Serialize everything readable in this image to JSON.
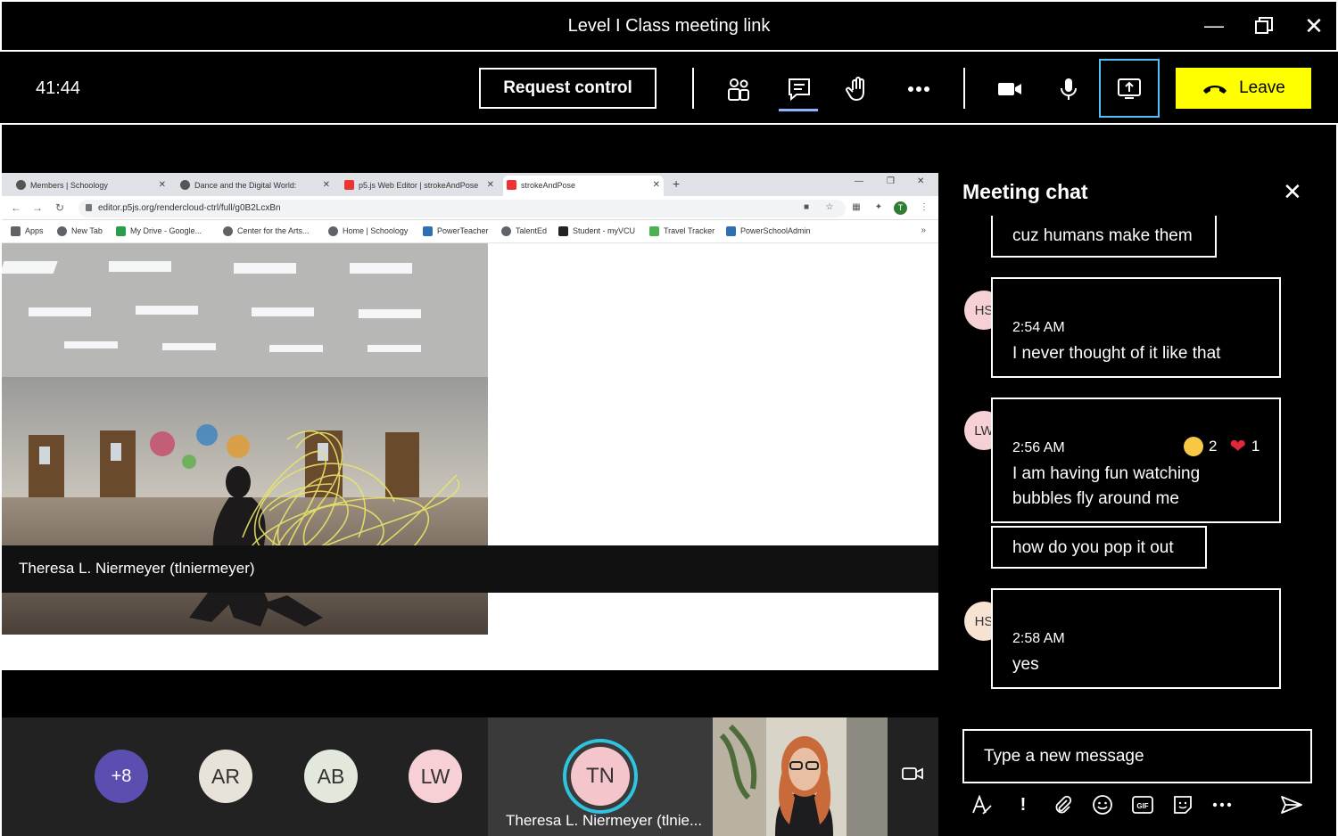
{
  "window": {
    "title": "Level I Class meeting link"
  },
  "toolbar": {
    "timer": "41:44",
    "request_control_label": "Request control",
    "leave_label": "Leave"
  },
  "browser": {
    "tabs": [
      {
        "title": "Members | Schoology"
      },
      {
        "title": "Dance and the Digital World:"
      },
      {
        "title": "p5.js Web Editor | strokeAndPose"
      },
      {
        "title": "strokeAndPose"
      }
    ],
    "url": "editor.p5js.org/rendercloud-ctrl/full/g0B2LcxBn",
    "bookmarks": [
      "Apps",
      "New Tab",
      "My Drive - Google...",
      "Center for the Arts...",
      "Home | Schoology",
      "PowerTeacher",
      "TalentEd",
      "Student - myVCU",
      "Travel Tracker",
      "PowerSchoolAdmin"
    ],
    "profile_initial": "T"
  },
  "stage": {
    "presenter_name": "Theresa L. Niermeyer (tlniermeyer)"
  },
  "participants": {
    "overflow_count": "+8",
    "avatars": [
      {
        "initials": "AR",
        "color": "#e8e3d9"
      },
      {
        "initials": "AB",
        "color": "#e2e8dc"
      },
      {
        "initials": "LW",
        "color": "#f6d0d4"
      }
    ],
    "active": {
      "initials": "TN",
      "name": "Theresa L. Niermeyer (tlnie..."
    }
  },
  "chat": {
    "title": "Meeting chat",
    "messages": [
      {
        "text": "cuz humans make them"
      },
      {
        "initials": "HS",
        "time": "2:54 AM",
        "text": "I never thought of it like that"
      },
      {
        "initials": "LW",
        "time": "2:56 AM",
        "lines": [
          "I am having fun watching",
          "bubbles fly around me"
        ],
        "reactions": {
          "laugh": "2",
          "heart": "1"
        }
      },
      {
        "text": "how do you pop it out"
      },
      {
        "initials": "HS",
        "time": "2:58 AM",
        "text": "yes"
      }
    ],
    "compose_placeholder": "Type a new message"
  },
  "colors": {
    "accent_leave": "#ffff00",
    "share_border": "#4fc3f7",
    "speaking_ring": "#2ec4e0",
    "overflow_avatar": "#5a4fb0"
  }
}
